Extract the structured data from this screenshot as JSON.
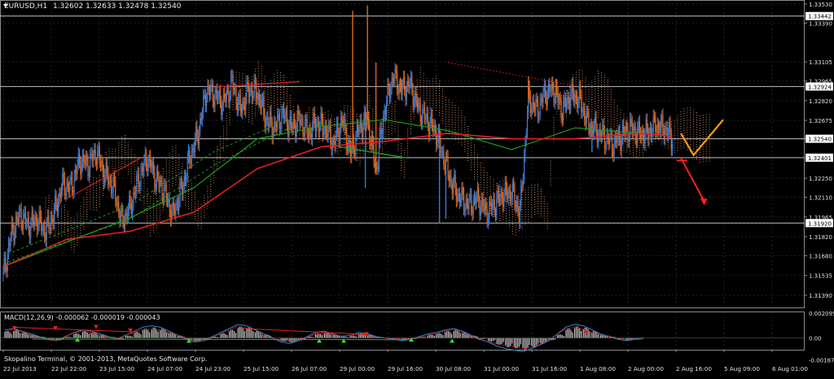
{
  "window": {
    "symbol": "EURUSD,H1",
    "ohlc": "1.32602 1.32633 1.32478 1.32540",
    "copyright": "Skopalino Terminal, © 2001-2013, MetaQuotes Software Corp."
  },
  "colors": {
    "background": "#000000",
    "grid": "#1f1f1f",
    "bull": "#3a7bd5",
    "bear": "#e06818",
    "ma_fast": "#e02020",
    "ma_slow": "#1f9a1f",
    "cloud": "#e8a070",
    "level_line": "#bfbfbf",
    "forecast_up": "#ff9a1a",
    "forecast_down": "#ff2020",
    "macd_hist": "#c8c8c8",
    "macd_signal": "#e02020",
    "macd_line": "#2a8ad5"
  },
  "chart_data": [
    {
      "type": "candlestick",
      "title": "EURUSD,H1",
      "ylim": [
        1.313,
        1.3356
      ],
      "y_ticks": [
        "1.33530",
        "1.33390",
        "1.33105",
        "1.32965",
        "1.32820",
        "1.32675",
        "1.32540",
        "1.32250",
        "1.32110",
        "1.31965",
        "1.31820",
        "1.31680",
        "1.31535",
        "1.31390"
      ],
      "highlight_levels": [
        {
          "label": "1.33442",
          "value": 1.33442
        },
        {
          "label": "1.32924",
          "value": 1.32924
        },
        {
          "label": "1.32540",
          "value": 1.3254
        },
        {
          "label": "1.32401",
          "value": 1.32401
        },
        {
          "label": "1.31920",
          "value": 1.3192
        }
      ],
      "x_labels": [
        "22 Jul 2013",
        "22 Jul 22:00",
        "23 Jul 15:00",
        "24 Jul 07:00",
        "24 Jul 23:00",
        "25 Jul 15:00",
        "26 Jul 07:00",
        "29 Jul 00:00",
        "29 Jul 16:00",
        "30 Jul 08:00",
        "31 Jul 00:00",
        "31 Jul 16:00",
        "1 Aug 08:00",
        "2 Aug 00:00",
        "2 Aug 16:00",
        "5 Aug 09:00",
        "6 Aug 01:00"
      ],
      "price_path": [
        [
          0,
          1.3154
        ],
        [
          8,
          1.3185
        ],
        [
          16,
          1.3198
        ],
        [
          24,
          1.319
        ],
        [
          32,
          1.3195
        ],
        [
          40,
          1.3185
        ],
        [
          48,
          1.32
        ],
        [
          56,
          1.322
        ],
        [
          64,
          1.3218
        ],
        [
          72,
          1.3238
        ],
        [
          80,
          1.3235
        ],
        [
          88,
          1.3244
        ],
        [
          96,
          1.3228
        ],
        [
          104,
          1.3218
        ],
        [
          112,
          1.3193
        ],
        [
          120,
          1.3204
        ],
        [
          128,
          1.3225
        ],
        [
          136,
          1.324
        ],
        [
          144,
          1.3225
        ],
        [
          152,
          1.3215
        ],
        [
          160,
          1.3198
        ],
        [
          168,
          1.3215
        ],
        [
          176,
          1.324
        ],
        [
          184,
          1.3258
        ],
        [
          192,
          1.329
        ],
        [
          200,
          1.3286
        ],
        [
          208,
          1.328
        ],
        [
          216,
          1.3295
        ],
        [
          224,
          1.3275
        ],
        [
          232,
          1.329
        ],
        [
          240,
          1.3288
        ],
        [
          248,
          1.3268
        ],
        [
          256,
          1.3262
        ],
        [
          264,
          1.3272
        ],
        [
          272,
          1.3262
        ],
        [
          280,
          1.3268
        ],
        [
          288,
          1.3258
        ],
        [
          296,
          1.3266
        ],
        [
          304,
          1.3262
        ],
        [
          312,
          1.325
        ],
        [
          320,
          1.3268
        ],
        [
          328,
          1.3242
        ],
        [
          336,
          1.3262
        ],
        [
          344,
          1.3268
        ],
        [
          352,
          1.323
        ],
        [
          360,
          1.3275
        ],
        [
          368,
          1.33
        ],
        [
          376,
          1.329
        ],
        [
          384,
          1.3294
        ],
        [
          392,
          1.3276
        ],
        [
          400,
          1.3268
        ],
        [
          408,
          1.326
        ],
        [
          416,
          1.324
        ],
        [
          424,
          1.322
        ],
        [
          432,
          1.321
        ],
        [
          440,
          1.3205
        ],
        [
          448,
          1.321
        ],
        [
          456,
          1.32
        ],
        [
          464,
          1.3206
        ],
        [
          472,
          1.3213
        ],
        [
          480,
          1.3215
        ],
        [
          488,
          1.32
        ],
        [
          496,
          1.3283
        ],
        [
          504,
          1.3275
        ],
        [
          512,
          1.3288
        ],
        [
          520,
          1.329
        ],
        [
          528,
          1.3275
        ],
        [
          536,
          1.3286
        ],
        [
          544,
          1.3283
        ],
        [
          552,
          1.3265
        ],
        [
          560,
          1.326
        ],
        [
          568,
          1.3255
        ],
        [
          576,
          1.325
        ],
        [
          584,
          1.3256
        ],
        [
          592,
          1.3262
        ],
        [
          600,
          1.3258
        ],
        [
          608,
          1.3258
        ],
        [
          616,
          1.3264
        ],
        [
          624,
          1.3262
        ],
        [
          632,
          1.3254
        ]
      ],
      "spikes": [
        [
          330,
          1.3348
        ],
        [
          342,
          1.3218
        ],
        [
          344,
          1.3352
        ],
        [
          352,
          1.331
        ],
        [
          376,
          1.3298
        ],
        [
          412,
          1.3192
        ],
        [
          418,
          1.3195
        ],
        [
          488,
          1.3188
        ],
        [
          496,
          1.33
        ],
        [
          522,
          1.3298
        ],
        [
          556,
          1.3244
        ]
      ],
      "ma_fast": [
        [
          0,
          1.316
        ],
        [
          60,
          1.318
        ],
        [
          120,
          1.3186
        ],
        [
          180,
          1.32
        ],
        [
          240,
          1.3232
        ],
        [
          300,
          1.3248
        ],
        [
          360,
          1.3252
        ],
        [
          420,
          1.3258
        ],
        [
          480,
          1.3254
        ],
        [
          540,
          1.3254
        ],
        [
          600,
          1.3258
        ],
        [
          632,
          1.3256
        ]
      ],
      "ma_slow": [
        [
          0,
          1.316
        ],
        [
          60,
          1.3178
        ],
        [
          120,
          1.3196
        ],
        [
          180,
          1.3218
        ],
        [
          240,
          1.3254
        ],
        [
          300,
          1.3263
        ],
        [
          360,
          1.3268
        ],
        [
          420,
          1.326
        ],
        [
          480,
          1.3246
        ],
        [
          540,
          1.3262
        ],
        [
          600,
          1.3258
        ],
        [
          632,
          1.3256
        ]
      ],
      "forecast_up": [
        [
          640,
          1.3258
        ],
        [
          652,
          1.3242
        ],
        [
          680,
          1.3268
        ]
      ],
      "forecast_down": [
        [
          640,
          1.324
        ],
        [
          662,
          1.3208
        ]
      ]
    },
    {
      "type": "bar",
      "title": "MACD(12,26,9) -0.000062 -0.000019 -0.000043",
      "ylim": [
        -0.001,
        0.00225
      ],
      "y_ticks": [
        "0.002099",
        "0.00",
        "-0.001875"
      ],
      "histogram": [
        0.0006,
        0.0007,
        0.0005,
        0.0003,
        0.0001,
        -0.0001,
        -0.0002,
        0.0001,
        0.0004,
        0.0006,
        0.0005,
        0.0003,
        0.0001,
        -0.0001,
        0.0002,
        0.0005,
        0.0008,
        0.0009,
        0.0008,
        0.0005,
        0.0002,
        -0.0001,
        -0.0003,
        -0.0002,
        0.0001,
        0.0004,
        0.0007,
        0.001,
        0.0009,
        0.0006,
        0.0003,
        0.0,
        -0.0003,
        -0.0004,
        -0.0002,
        0.0001,
        0.0004,
        0.0005,
        0.0003,
        0.0001,
        0.0002,
        0.0004,
        0.0003,
        0.0001,
        0.0,
        -0.0001,
        -0.0002,
        -0.0001,
        0.0001,
        0.0003,
        0.0004,
        0.0006,
        0.0007,
        0.0005,
        0.0002,
        -0.0001,
        -0.0003,
        -0.0006,
        -0.0008,
        -0.0009,
        -0.001,
        -0.0008,
        -0.0005,
        -0.0002,
        0.0003,
        0.0008,
        0.001,
        0.0009,
        0.0006,
        0.0003,
        0.0001,
        -0.0001,
        -0.0002,
        -0.0001,
        0.0
      ]
    }
  ]
}
